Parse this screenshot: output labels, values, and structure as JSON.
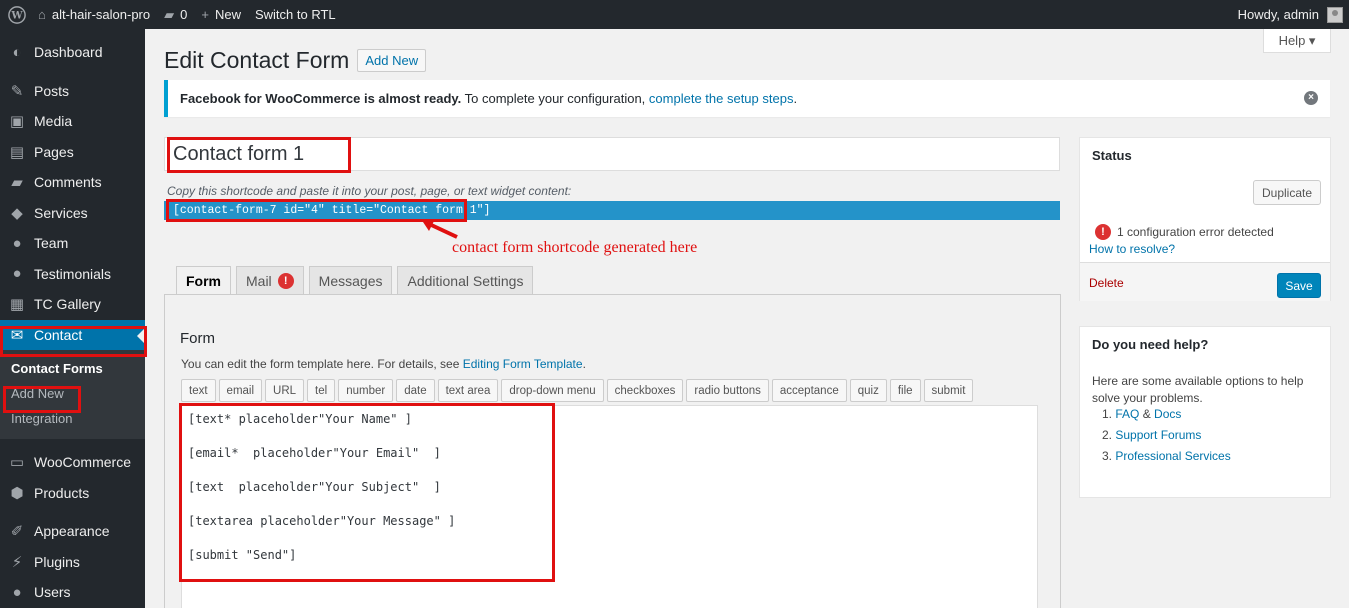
{
  "adminbar": {
    "site_name": "alt-hair-salon-pro",
    "comments_count": "0",
    "new_label": "New",
    "rtl_label": "Switch to RTL",
    "howdy": "Howdy, admin"
  },
  "sidebar": {
    "items": [
      {
        "label": "Dashboard",
        "icon": "dashboard-icon"
      },
      {
        "label": "Posts",
        "icon": "pin-icon"
      },
      {
        "label": "Media",
        "icon": "media-icon"
      },
      {
        "label": "Pages",
        "icon": "pages-icon"
      },
      {
        "label": "Comments",
        "icon": "comment-icon"
      },
      {
        "label": "Services",
        "icon": "tag-icon"
      },
      {
        "label": "Team",
        "icon": "user-icon"
      },
      {
        "label": "Testimonials",
        "icon": "user-icon"
      },
      {
        "label": "TC Gallery",
        "icon": "gallery-icon"
      },
      {
        "label": "Contact",
        "icon": "mail-icon"
      }
    ],
    "submenu": [
      "Contact Forms",
      "Add New",
      "Integration"
    ],
    "items2": [
      {
        "label": "WooCommerce",
        "icon": "woo-icon"
      },
      {
        "label": "Products",
        "icon": "box-icon"
      },
      {
        "label": "Appearance",
        "icon": "brush-icon"
      },
      {
        "label": "Plugins",
        "icon": "plug-icon"
      },
      {
        "label": "Users",
        "icon": "user-icon"
      }
    ]
  },
  "main": {
    "help_label": "Help ▾",
    "title": "Edit Contact Form",
    "add_new": "Add New",
    "notice": {
      "bold": "Facebook for WooCommerce is almost ready.",
      "text": " To complete your configuration, ",
      "link": "complete the setup steps",
      "end": "."
    },
    "form_title": "Contact form 1",
    "shortcode_label": "Copy this shortcode and paste it into your post, page, or text widget content:",
    "shortcode": "[contact-form-7 id=\"4\" title=\"Contact form 1\"]",
    "annotation": "contact form shortcode generated here",
    "tabs": [
      "Form",
      "Mail",
      "Messages",
      "Additional Settings"
    ],
    "mail_badge": "!",
    "panel_heading": "Form",
    "panel_desc": "You can edit the form template here. For details, see ",
    "panel_desc_link": "Editing Form Template",
    "panel_desc_end": ".",
    "tag_buttons": [
      "text",
      "email",
      "URL",
      "tel",
      "number",
      "date",
      "text area",
      "drop-down menu",
      "checkboxes",
      "radio buttons",
      "acceptance",
      "quiz",
      "file",
      "submit"
    ],
    "code_lines": [
      "[text* placeholder\"Your Name\" ]",
      "[email*  placeholder\"Your Email\"  ]",
      "[text  placeholder\"Your Subject\"  ]",
      "[textarea placeholder\"Your Message\" ]",
      "[submit \"Send\"]"
    ]
  },
  "status_box": {
    "title": "Status",
    "duplicate": "Duplicate",
    "error_text": "1 configuration error detected",
    "resolve_link": "How to resolve?",
    "delete": "Delete",
    "save": "Save"
  },
  "help_box": {
    "title": "Do you need help?",
    "intro": "Here are some available options to help solve your problems.",
    "faq": "FAQ",
    "amp": " & ",
    "docs": "Docs",
    "support": "Support Forums",
    "pro": "Professional Services"
  },
  "colors": {
    "adminbar": "#23282d",
    "accent": "#0073aa",
    "highlight": "#e01010",
    "shortcode_bg": "#2493c9"
  }
}
